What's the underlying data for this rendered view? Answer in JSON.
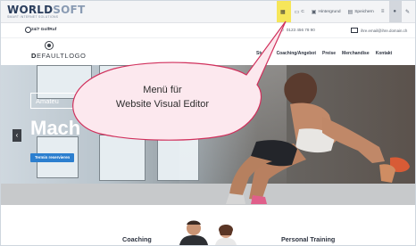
{
  "toolbar": {
    "brand_prefix": "W",
    "brand_mid": "ORLD",
    "brand_suffix": "SOFT",
    "brand_tagline": "SMART INTERNET SOLUTIONS",
    "tools": [
      {
        "label": "",
        "icon": "layout-grid-icon",
        "active": true
      },
      {
        "label": "C",
        "icon": "monitor-icon"
      },
      {
        "label": "Hintergrund",
        "icon": "image-icon"
      },
      {
        "label": "Speichern",
        "icon": "save-icon"
      },
      {
        "label": "",
        "icon": "menu-icon"
      },
      {
        "label": "",
        "icon": "user-icon",
        "selected": true
      },
      {
        "label": "",
        "icon": "pencil-icon"
      }
    ]
  },
  "contact": {
    "hotline": "24/7 GolfRuf",
    "phone": "0123 456 78 90",
    "email": "ihre.email@ihre.domain.ch"
  },
  "nav": {
    "logo_prefix": "D",
    "logo_rest": "EFAULT",
    "logo_suffix": "LOGO",
    "items": [
      "Studio",
      "Coaching/Angebot",
      "Preise",
      "Merchandise",
      "Kontakt"
    ]
  },
  "hero": {
    "tag": "Amateu",
    "headline": "Mach",
    "cta": "Termin reservieren"
  },
  "sections": {
    "left": "Coaching",
    "right": "Personal Training"
  },
  "callout": {
    "line1": "Menü für",
    "line2": "Website Visual Editor",
    "fill": "#fce8ee",
    "stroke": "#d1305c"
  }
}
